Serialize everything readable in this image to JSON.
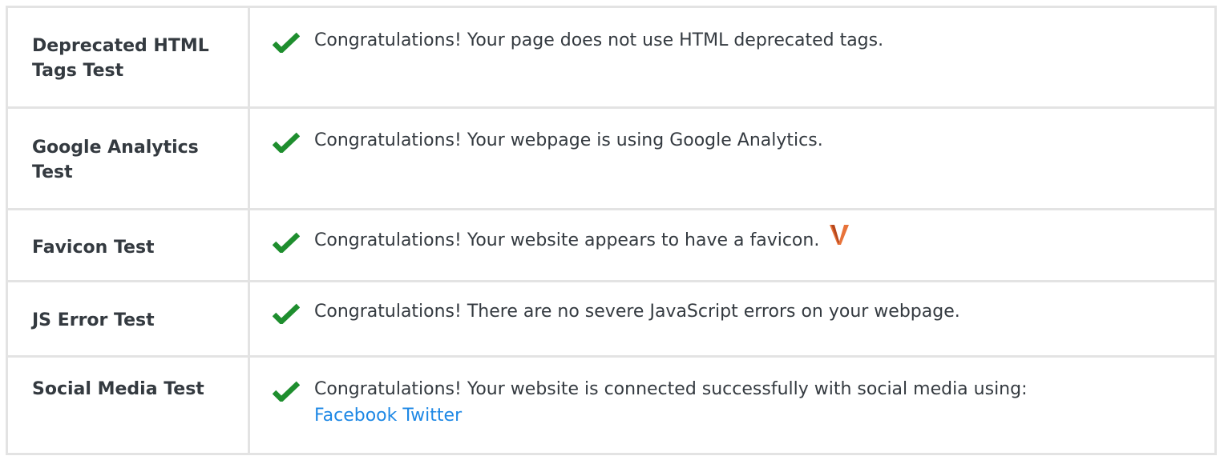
{
  "tests": [
    {
      "label": "Deprecated HTML Tags Test",
      "status_icon": "check-icon",
      "message": "Congratulations! Your page does not use HTML deprecated tags."
    },
    {
      "label": "Google Analytics Test",
      "status_icon": "check-icon",
      "message": "Congratulations! Your webpage is using Google Analytics."
    },
    {
      "label": "Favicon Test",
      "status_icon": "check-icon",
      "message": "Congratulations! Your website appears to have a favicon.",
      "favicon_icon": "favicon-v-icon"
    },
    {
      "label": "JS Error Test",
      "status_icon": "check-icon",
      "message": "Congratulations! There are no severe JavaScript errors on your webpage."
    },
    {
      "label": "Social Media Test",
      "status_icon": "check-icon",
      "message": "Congratulations! Your website is connected successfully with social media using:",
      "links": [
        "Facebook",
        "Twitter"
      ]
    }
  ],
  "colors": {
    "check": "#1e8e2e",
    "link": "#1e88e5",
    "text": "#343a40",
    "border": "#e3e3e3",
    "favicon": "#e8733a"
  }
}
